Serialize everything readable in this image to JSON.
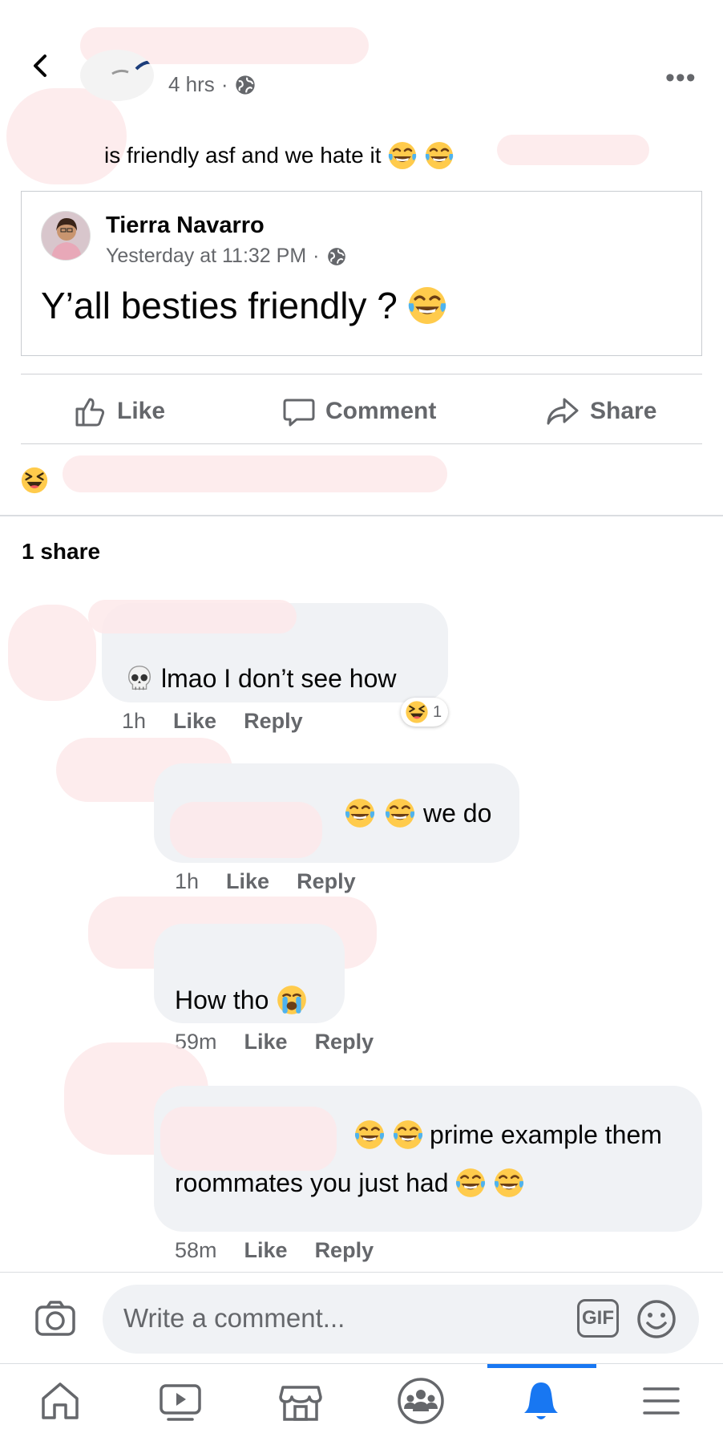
{
  "post": {
    "time": "4 hrs",
    "dot": "·",
    "text": "is friendly asf and we hate it",
    "more_label": "•••"
  },
  "shared_post": {
    "author": "Tierra Navarro",
    "time": "Yesterday at 11:32 PM",
    "dot": "·",
    "text": "Y’all besties friendly ?"
  },
  "actions": {
    "like": "Like",
    "comment": "Comment",
    "share": "Share"
  },
  "shares": "1 share",
  "comments": [
    {
      "text": "lmao I don’t see how",
      "time": "1h",
      "like": "Like",
      "reply": "Reply",
      "reaction_count": "1"
    },
    {
      "text": "we do",
      "time": "1h",
      "like": "Like",
      "reply": "Reply"
    },
    {
      "text": "How tho",
      "time": "59m",
      "like": "Like",
      "reply": "Reply"
    },
    {
      "text_line1": "prime example them",
      "text_line2": "roommates you just had",
      "time": "58m",
      "like": "Like",
      "reply": "Reply"
    }
  ],
  "composer": {
    "placeholder": "Write a comment...",
    "gif_label": "GIF"
  },
  "nav": [
    "home-icon",
    "video-icon",
    "marketplace-icon",
    "groups-icon",
    "notifications-icon",
    "menu-icon"
  ],
  "colors": {
    "accent": "#1877f2",
    "secondary_text": "#65676b",
    "bubble": "#f0f2f5",
    "emoji_yellow": "#ffcb4c"
  }
}
